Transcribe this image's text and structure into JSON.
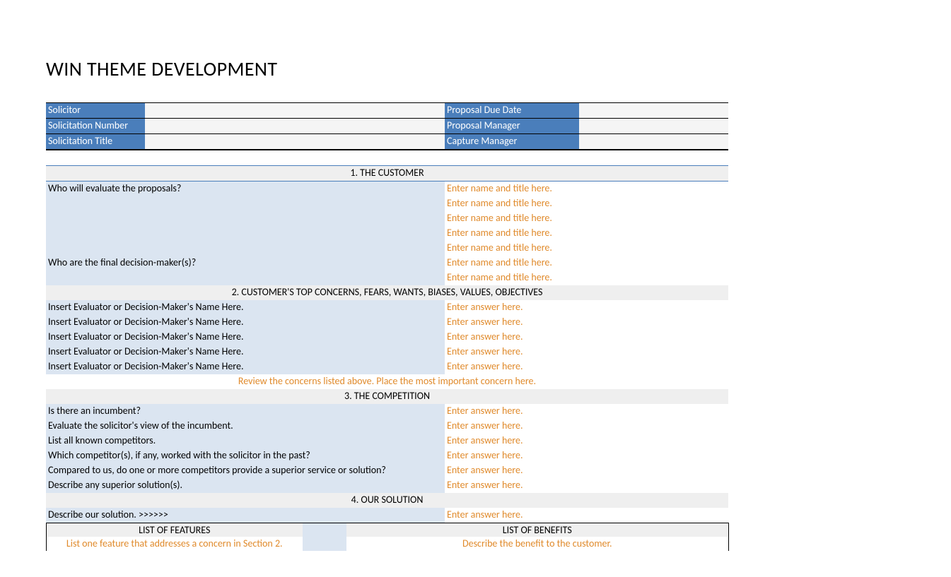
{
  "title": "WIN THEME DEVELOPMENT",
  "header": {
    "left": [
      "Solicitor",
      "Solicitation Number",
      "Solicitation Title"
    ],
    "right": [
      "Proposal Due Date",
      "Proposal Manager",
      "Capture Manager"
    ]
  },
  "sections": {
    "s1": {
      "title": "1. THE CUSTOMER",
      "q1": "Who will evaluate the proposals?",
      "q1_entries": [
        "Enter name and title here.",
        "Enter name and title here.",
        "Enter name and title here.",
        "Enter name and title here.",
        "Enter name and title here."
      ],
      "q2": "Who are the final decision-maker(s)?",
      "q2_entries": [
        "Enter name and title here.",
        "Enter name and title here."
      ]
    },
    "s2": {
      "title": "2. CUSTOMER'S TOP CONCERNS, FEARS, WANTS, BIASES, VALUES, OBJECTIVES",
      "rows": [
        {
          "name": "Insert Evaluator or Decision-Maker's Name Here.",
          "ans": "Enter answer here."
        },
        {
          "name": "Insert Evaluator or Decision-Maker's Name Here.",
          "ans": "Enter answer here."
        },
        {
          "name": "Insert Evaluator or Decision-Maker's Name Here.",
          "ans": "Enter answer here."
        },
        {
          "name": "Insert Evaluator or Decision-Maker's Name Here.",
          "ans": "Enter answer here."
        },
        {
          "name": "Insert Evaluator or Decision-Maker's Name Here.",
          "ans": "Enter answer here."
        }
      ],
      "review": "Review the concerns listed above. Place the most important concern here."
    },
    "s3": {
      "title": "3. THE COMPETITION",
      "rows": [
        {
          "q": "Is there an incumbent?",
          "a": "Enter answer here."
        },
        {
          "q": "Evaluate the solicitor's view of the incumbent.",
          "a": "Enter answer here."
        },
        {
          "q": "List all known competitors.",
          "a": "Enter answer here."
        },
        {
          "q": "Which competitor(s), if any, worked with the solicitor in the past?",
          "a": "Enter answer here."
        },
        {
          "q": "Compared to us, do one or more competitors provide a superior service or solution?",
          "a": "Enter answer here."
        },
        {
          "q": "Describe any superior solution(s).",
          "a": "Enter answer here."
        }
      ]
    },
    "s4": {
      "title": "4. OUR SOLUTION",
      "desc_q": "Describe our solution. >>>>>>",
      "desc_a": "Enter answer here.",
      "features_title": "LIST OF FEATURES",
      "benefits_title": "LIST OF BENEFITS",
      "feature_ph": "List one feature that addresses a concern in Section 2.",
      "benefit_ph": "Describe the benefit to the customer."
    }
  }
}
